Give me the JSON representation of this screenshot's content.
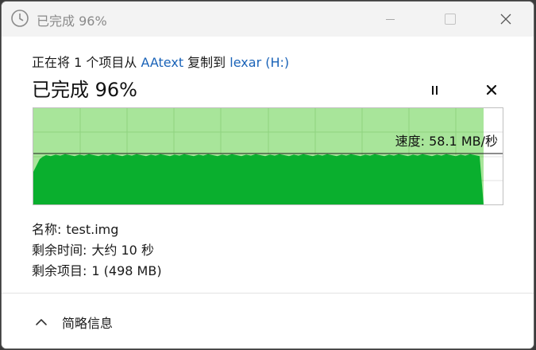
{
  "titlebar": {
    "title": "已完成 96%",
    "icon": "clock-icon"
  },
  "operation": {
    "prefix": "正在将 1 个项目从 ",
    "source": "AAtext",
    "middle": " 复制到 ",
    "destination": "lexar (H:)"
  },
  "status": {
    "label": "已完成 96%",
    "percent_complete": 96
  },
  "graph": {
    "speed_label": "速度: 58.1 MB/秒",
    "fill_color": "#0aaf2e",
    "remaining_color": "#a8e59a",
    "grid_color": "#8fd27f"
  },
  "details": {
    "name_key": "名称:",
    "name_value": "test.img",
    "time_key": "剩余时间:",
    "time_value": "大约 10 秒",
    "items_key": "剩余项目:",
    "items_value": "1 (498 MB)"
  },
  "footer": {
    "toggle_label": "简略信息",
    "toggle_icon": "chevron-up-icon"
  }
}
